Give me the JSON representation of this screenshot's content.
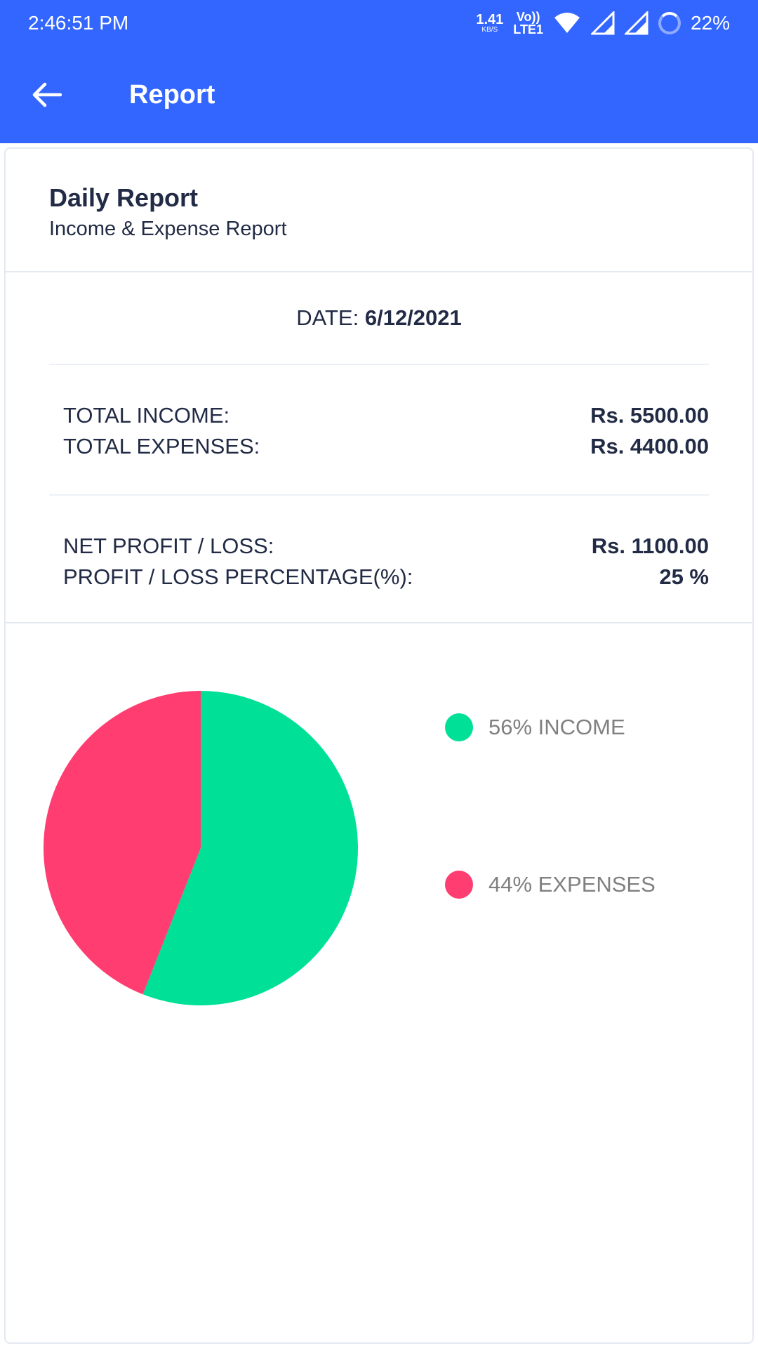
{
  "status_bar": {
    "time": "2:46:51 PM",
    "net_speed": "1.41",
    "net_unit": "KB/S",
    "volte_top": "Vo))",
    "volte_bottom": "LTE1",
    "battery": "22%"
  },
  "app_bar": {
    "title": "Report",
    "back_icon": "arrow-left-icon"
  },
  "card": {
    "title": "Daily Report",
    "subtitle": "Income & Expense Report",
    "date_label": "DATE: ",
    "date_value": "6/12/2021",
    "total_income_label": "TOTAL INCOME:",
    "total_income_value": "Rs. 5500.00",
    "total_expenses_label": "TOTAL EXPENSES:",
    "total_expenses_value": "Rs. 4400.00",
    "net_label": "NET PROFIT / LOSS:",
    "net_value": "Rs. 1100.00",
    "pct_label": "PROFIT / LOSS PERCENTAGE(%):",
    "pct_value": "25 %"
  },
  "colors": {
    "primary": "#3366ff",
    "income": "#00e096",
    "expenses": "#ff3d71"
  },
  "chart_data": {
    "type": "pie",
    "slices": [
      {
        "label": "56% INCOME",
        "value": 56,
        "color": "#00e096"
      },
      {
        "label": "44% EXPENSES",
        "value": 44,
        "color": "#ff3d71"
      }
    ],
    "legend_position": "right"
  }
}
